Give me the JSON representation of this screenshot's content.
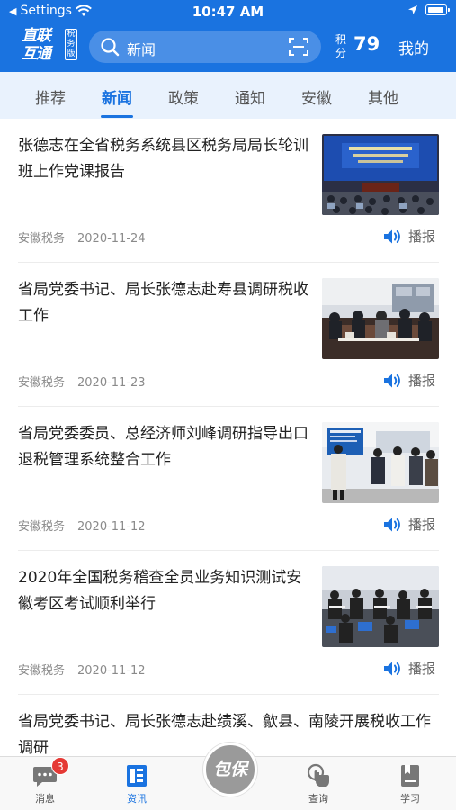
{
  "status_bar": {
    "back_label": "Settings",
    "time": "10:47 AM"
  },
  "header": {
    "logo_main": "直联互通",
    "logo_side": "税务版",
    "search_text": "新闻",
    "points_label": "积分",
    "points_value": "79",
    "mine_label": "我的",
    "accent": "#1a73e0"
  },
  "tabs": [
    {
      "label": "推荐"
    },
    {
      "label": "新闻",
      "active": true
    },
    {
      "label": "政策"
    },
    {
      "label": "通知"
    },
    {
      "label": "安徽"
    },
    {
      "label": "其他"
    }
  ],
  "news": [
    {
      "title": "张德志在全省税务系统县区税务局局长轮训班上作党课报告",
      "source": "安徽税务",
      "date": "2020-11-24",
      "play_label": "播报",
      "thumb": "lecture-hall-photo"
    },
    {
      "title": "省局党委书记、局长张德志赴寿县调研税收工作",
      "source": "安徽税务",
      "date": "2020-11-23",
      "play_label": "播报",
      "thumb": "meeting-room-photo"
    },
    {
      "title": "省局党委委员、总经济师刘峰调研指导出口退税管理系统整合工作",
      "source": "安徽税务",
      "date": "2020-11-12",
      "play_label": "播报",
      "thumb": "office-visit-photo"
    },
    {
      "title": "2020年全国税务稽查全员业务知识测试安徽考区考试顺利举行",
      "source": "安徽税务",
      "date": "2020-11-12",
      "play_label": "播报",
      "thumb": "exam-room-photo"
    },
    {
      "title": "省局党委书记、局长张德志赴绩溪、歙县、南陵开展税收工作调研"
    }
  ],
  "bottom_nav": {
    "messages": {
      "label": "消息",
      "badge": "3"
    },
    "news": {
      "label": "资讯"
    },
    "center": {
      "label": "包保"
    },
    "query": {
      "label": "查询"
    },
    "study": {
      "label": "学习"
    }
  }
}
